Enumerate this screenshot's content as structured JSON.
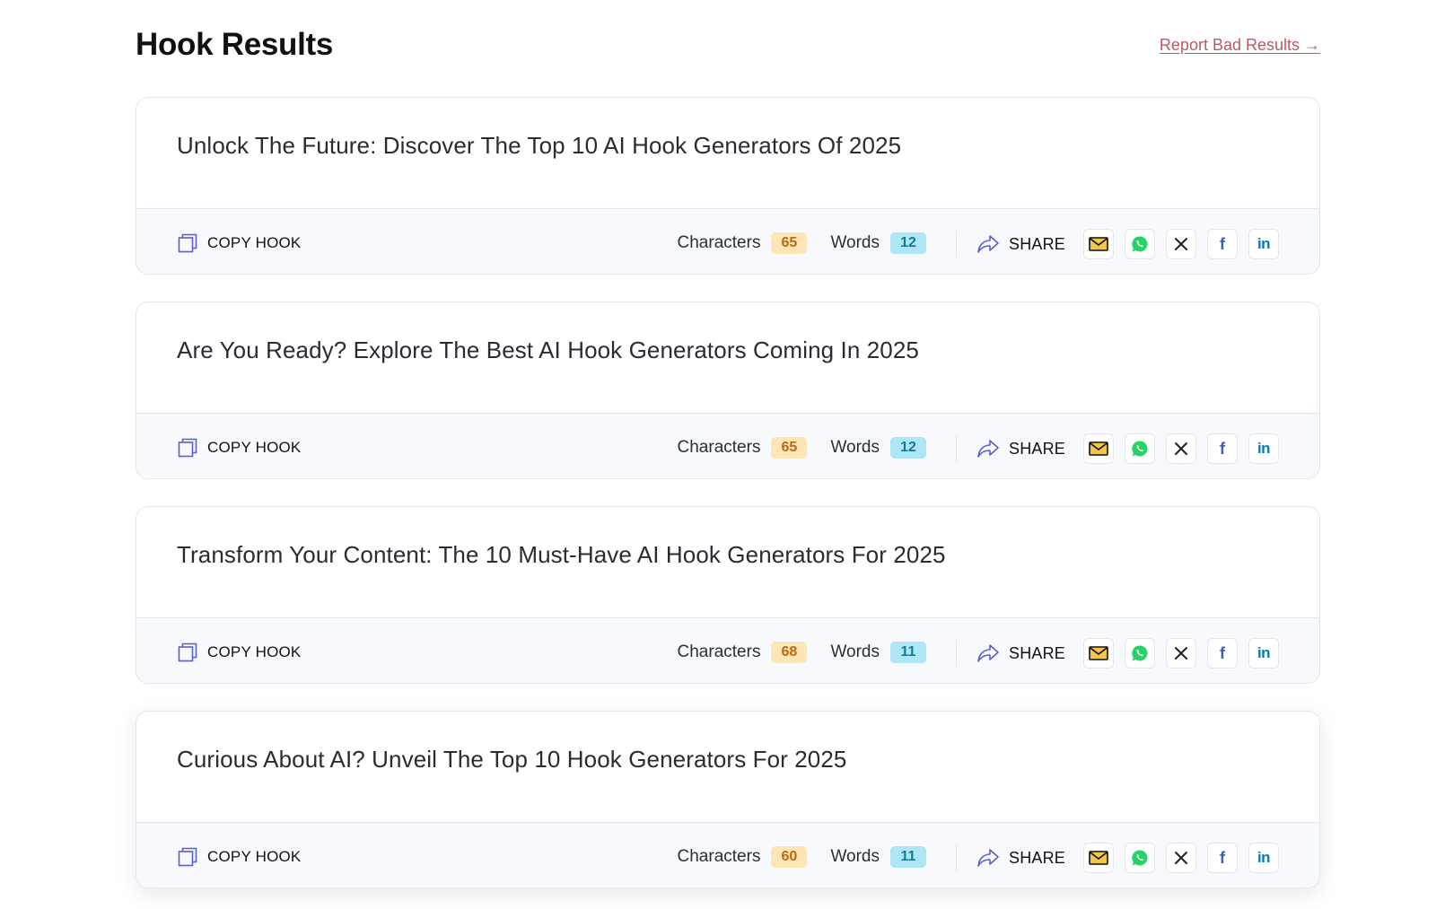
{
  "page": {
    "title": "Hook Results",
    "report_link": "Report Bad Results →"
  },
  "labels": {
    "copy": "COPY HOOK",
    "characters": "Characters",
    "words": "Words",
    "share": "SHARE"
  },
  "colors": {
    "report_link": "#b85b63",
    "chars_badge_bg": "#fde5b5",
    "chars_badge_text": "#b76a14",
    "words_badge_bg": "#aee6f5",
    "words_badge_text": "#137a9a",
    "icon_accent": "#5b5fc7",
    "whatsapp": "#25d366"
  },
  "icons": {
    "copy": "copy-icon",
    "share": "share-arrow-icon",
    "email": "envelope-icon",
    "whatsapp": "whatsapp-icon",
    "x": "x-icon",
    "facebook": "facebook-icon",
    "linkedin": "linkedin-icon"
  },
  "hooks": [
    {
      "text": "Unlock The Future: Discover The Top 10 AI Hook Generators Of 2025",
      "characters": "65",
      "words": "12"
    },
    {
      "text": "Are You Ready? Explore The Best AI Hook Generators Coming In 2025",
      "characters": "65",
      "words": "12"
    },
    {
      "text": "Transform Your Content: The 10 Must-Have AI Hook Generators For 2025",
      "characters": "68",
      "words": "11"
    },
    {
      "text": "Curious About AI? Unveil The Top 10 Hook Generators For 2025",
      "characters": "60",
      "words": "11"
    }
  ]
}
